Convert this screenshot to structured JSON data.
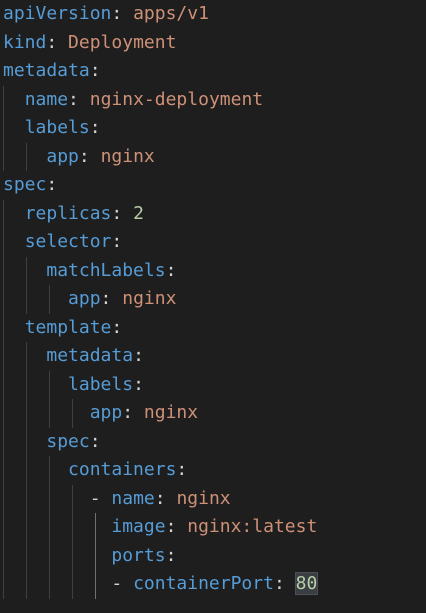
{
  "colors": {
    "background": "#1e1e1e",
    "key": "#569cd6",
    "string": "#ce9178",
    "number": "#b5cea8",
    "punctuation": "#d4d4d4",
    "indent_guide": "#404040",
    "active_indent_guide": "#707070"
  },
  "lines": [
    {
      "indent": 0,
      "dash": false,
      "key": "apiVersion",
      "value": "apps/v1",
      "value_type": "string"
    },
    {
      "indent": 0,
      "dash": false,
      "key": "kind",
      "value": "Deployment",
      "value_type": "string"
    },
    {
      "indent": 0,
      "dash": false,
      "key": "metadata",
      "value": "",
      "value_type": "none"
    },
    {
      "indent": 1,
      "dash": false,
      "key": "name",
      "value": "nginx-deployment",
      "value_type": "string"
    },
    {
      "indent": 1,
      "dash": false,
      "key": "labels",
      "value": "",
      "value_type": "none"
    },
    {
      "indent": 2,
      "dash": false,
      "key": "app",
      "value": "nginx",
      "value_type": "string"
    },
    {
      "indent": 0,
      "dash": false,
      "key": "spec",
      "value": "",
      "value_type": "none"
    },
    {
      "indent": 1,
      "dash": false,
      "key": "replicas",
      "value": "2",
      "value_type": "number"
    },
    {
      "indent": 1,
      "dash": false,
      "key": "selector",
      "value": "",
      "value_type": "none"
    },
    {
      "indent": 2,
      "dash": false,
      "key": "matchLabels",
      "value": "",
      "value_type": "none"
    },
    {
      "indent": 3,
      "dash": false,
      "key": "app",
      "value": "nginx",
      "value_type": "string"
    },
    {
      "indent": 1,
      "dash": false,
      "key": "template",
      "value": "",
      "value_type": "none"
    },
    {
      "indent": 2,
      "dash": false,
      "key": "metadata",
      "value": "",
      "value_type": "none"
    },
    {
      "indent": 3,
      "dash": false,
      "key": "labels",
      "value": "",
      "value_type": "none"
    },
    {
      "indent": 4,
      "dash": false,
      "key": "app",
      "value": "nginx",
      "value_type": "string"
    },
    {
      "indent": 2,
      "dash": false,
      "key": "spec",
      "value": "",
      "value_type": "none"
    },
    {
      "indent": 3,
      "dash": false,
      "key": "containers",
      "value": "",
      "value_type": "none"
    },
    {
      "indent": 4,
      "dash": true,
      "key": "name",
      "value": "nginx",
      "value_type": "string"
    },
    {
      "indent": 5,
      "dash": false,
      "key": "image",
      "value": "nginx:latest",
      "value_type": "string"
    },
    {
      "indent": 5,
      "dash": false,
      "key": "ports",
      "value": "",
      "value_type": "none"
    },
    {
      "indent": 5,
      "dash": true,
      "key": "containerPort",
      "value": "80",
      "value_type": "number",
      "highlighted": true
    }
  ]
}
